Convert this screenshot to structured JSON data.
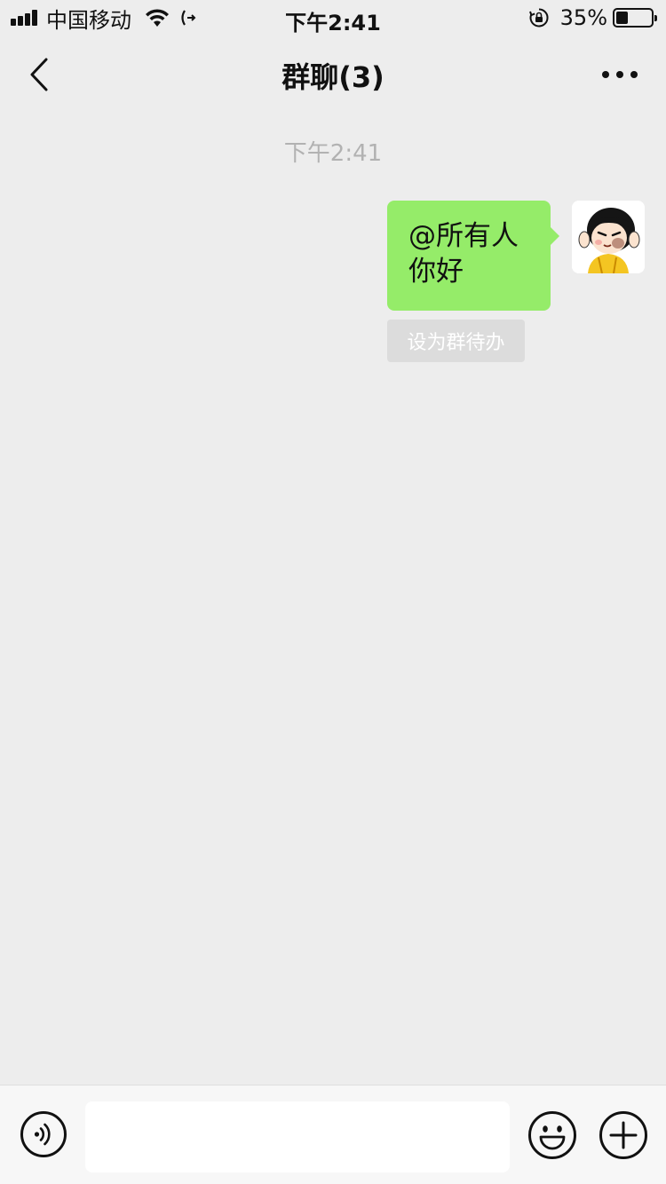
{
  "status_bar": {
    "carrier": "中国移动",
    "time": "下午2:41",
    "battery_percent": "35%",
    "battery_level": 0.35,
    "icons": [
      "signal-icon",
      "wifi-icon",
      "call-forward-icon",
      "rotation-lock-icon",
      "battery-icon"
    ]
  },
  "nav": {
    "title": "群聊(3)",
    "back_icon": "chevron-left-icon",
    "more_icon": "more-dots-icon"
  },
  "chat": {
    "timestamp": "下午2:41",
    "message": {
      "line1": "@所有人",
      "line2": "你好",
      "bubble_color": "#95ec69"
    },
    "todo_button": "设为群待办"
  },
  "input_bar": {
    "voice_icon": "voice-icon",
    "emoji_icon": "emoji-icon",
    "plus_icon": "plus-icon",
    "text_value": ""
  },
  "colors": {
    "background": "#ededed",
    "bubble": "#95ec69",
    "timestamp": "#b2b2b2"
  }
}
